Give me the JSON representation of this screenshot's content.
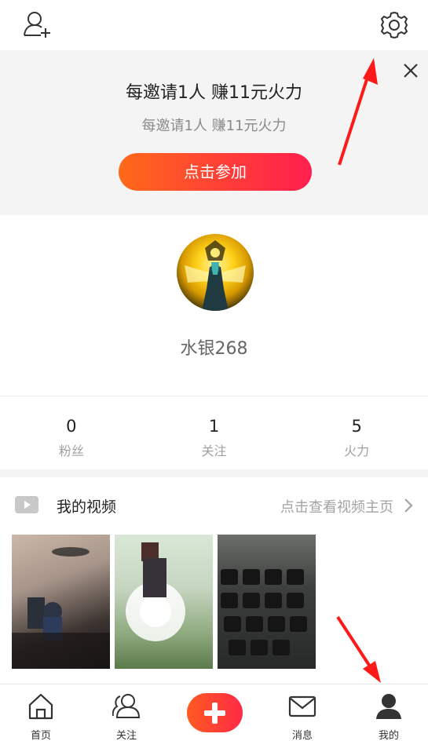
{
  "topbar": {
    "add_user_icon": "add-user-icon",
    "settings_icon": "gear-icon"
  },
  "banner": {
    "title": "每邀请1人 赚11元火力",
    "subtitle": "每邀请1人 赚11元火力",
    "button_label": "点击参加",
    "close_icon": "close-icon",
    "button_colors": [
      "#ff6a1a",
      "#ff1f4f"
    ]
  },
  "profile": {
    "username": "水银268"
  },
  "stats": [
    {
      "value": "0",
      "label": "粉丝"
    },
    {
      "value": "1",
      "label": "关注"
    },
    {
      "value": "5",
      "label": "火力"
    }
  ],
  "videos": {
    "title": "我的视频",
    "link_label": "点击查看视频主页",
    "icon": "play-icon"
  },
  "bottom_nav": {
    "items": [
      {
        "label": "首页",
        "icon": "home-icon"
      },
      {
        "label": "关注",
        "icon": "users-icon"
      },
      {
        "label": "",
        "icon": "plus-icon"
      },
      {
        "label": "消息",
        "icon": "mail-icon"
      },
      {
        "label": "我的",
        "icon": "person-icon"
      }
    ]
  },
  "annotations": {
    "arrow_color": "#ff1a1a"
  }
}
